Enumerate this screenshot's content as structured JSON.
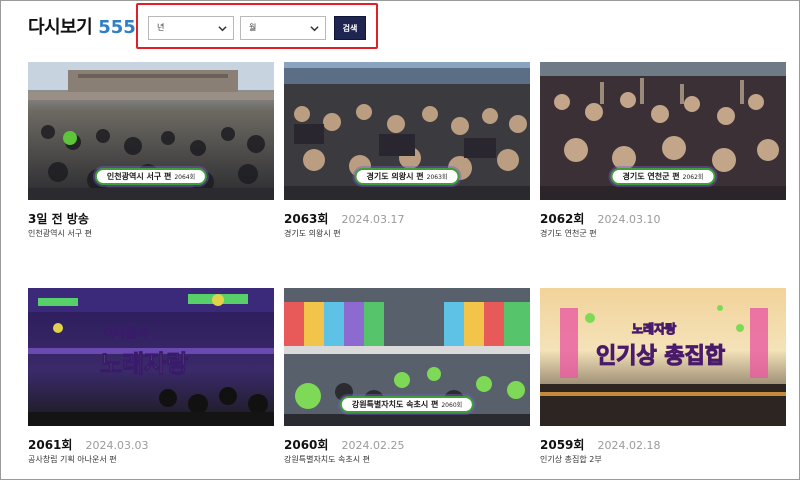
{
  "page": {
    "title": "다시보기",
    "count": "555"
  },
  "filters": {
    "year_label": "년",
    "month_label": "월",
    "search_label": "검색"
  },
  "episodes": [
    {
      "episode": "3일 전 방송",
      "date": "",
      "subtitle": "인천광역시 서구 편",
      "caption": "인천광역시 서구 편",
      "caption_num": "2064회"
    },
    {
      "episode": "2063회",
      "date": "2024.03.17",
      "subtitle": "경기도 의왕시 편",
      "caption": "경기도 의왕시 편",
      "caption_num": "2063회"
    },
    {
      "episode": "2062회",
      "date": "2024.03.10",
      "subtitle": "경기도 연천군 편",
      "caption": "경기도 연천군 편",
      "caption_num": "2062회"
    },
    {
      "episode": "2061회",
      "date": "2024.03.03",
      "subtitle": "공사창립 기획 아나운서 편",
      "logo_top": "아나운서",
      "logo_main": "노래자랑"
    },
    {
      "episode": "2060회",
      "date": "2024.02.25",
      "subtitle": "강원특별자치도 속초시 편",
      "caption": "강원특별자치도 속초시 편",
      "caption_num": "2060회"
    },
    {
      "episode": "2059회",
      "date": "2024.02.18",
      "subtitle": "인기상 총집합 2부",
      "logo_top": "노래자랑",
      "logo_main": "인기상 총집합"
    }
  ]
}
